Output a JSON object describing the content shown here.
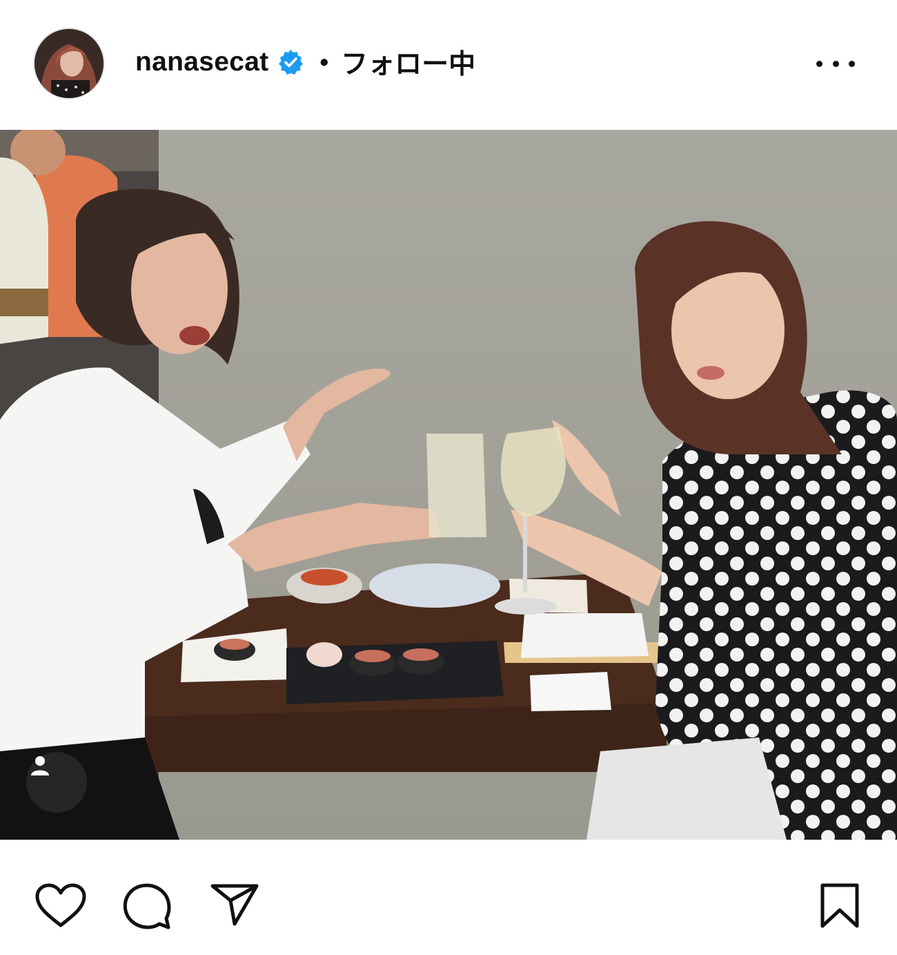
{
  "post": {
    "username": "nanasecat",
    "separator": "•",
    "follow_status": "フォロー中",
    "verified": true
  },
  "icons": {
    "more": "more-options-icon",
    "verified": "verified-badge-icon",
    "tag": "user-tag-icon",
    "like": "heart-icon",
    "comment": "comment-icon",
    "share": "send-icon",
    "save": "bookmark-icon"
  },
  "colors": {
    "verified_blue": "#1d9bf0",
    "text": "#111111",
    "tag_badge": "#262626"
  }
}
